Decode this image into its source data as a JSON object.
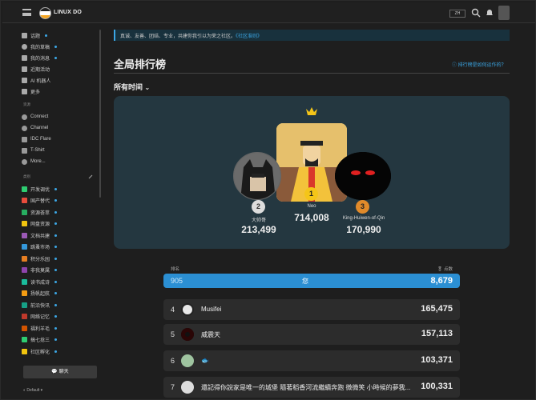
{
  "header": {
    "brand": "LINUX DO",
    "lang": "ZH"
  },
  "sidebar": {
    "top_items": [
      {
        "label": "话题",
        "dot": true
      },
      {
        "label": "我的草稿",
        "dot": true
      },
      {
        "label": "我的消息",
        "dot": true
      },
      {
        "label": "近期活动",
        "dot": false
      },
      {
        "label": "AI 机器人",
        "dot": false
      },
      {
        "label": "更多",
        "dot": false
      }
    ],
    "resources_title": "资源",
    "resources": [
      {
        "label": "Connect"
      },
      {
        "label": "Channel"
      },
      {
        "label": "IDC Flare"
      },
      {
        "label": "T-Shirt"
      },
      {
        "label": "More..."
      }
    ],
    "categories_title": "类别",
    "categories": [
      {
        "label": "开发调优",
        "color": "#2ecc71"
      },
      {
        "label": "国产替代",
        "color": "#e74c3c"
      },
      {
        "label": "资源荟萃",
        "color": "#27ae60"
      },
      {
        "label": "网盘资源",
        "color": "#f1c40f"
      },
      {
        "label": "文档共建",
        "color": "#9b59b6"
      },
      {
        "label": "跳蚤市场",
        "color": "#3498db"
      },
      {
        "label": "积分乐园",
        "color": "#e67e22"
      },
      {
        "label": "非我莫属",
        "color": "#8e44ad"
      },
      {
        "label": "读书成诗",
        "color": "#1abc9c"
      },
      {
        "label": "扬帆起航",
        "color": "#f39c12"
      },
      {
        "label": "前沿快讯",
        "color": "#16a085"
      },
      {
        "label": "网络记忆",
        "color": "#c0392b"
      },
      {
        "label": "福利羊毛",
        "color": "#d35400"
      },
      {
        "label": "搞七捻三",
        "color": "#2ecc71"
      },
      {
        "label": "社区孵化",
        "color": "#f1c40f"
      }
    ],
    "chat_label": "聊天",
    "footer_theme": "Default"
  },
  "banner": {
    "text": "真诚、友善、团结、专业，共建你我引以为荣之社区。",
    "link": "《社区准则》"
  },
  "page": {
    "title": "全局排行榜",
    "how_link": "排行榜是如何运作的？",
    "period": "所有时间"
  },
  "podium": [
    {
      "rank": "1",
      "name": "Neo",
      "score": "714,008"
    },
    {
      "rank": "2",
      "name": "大帅哥",
      "score": "213,499"
    },
    {
      "rank": "3",
      "name": "King-Huiwen-of-Qin",
      "score": "170,990"
    }
  ],
  "table": {
    "col_rank": "排名",
    "col_points": "点数",
    "me": {
      "rank": "905",
      "name": "您",
      "points": "8,679"
    },
    "rows": [
      {
        "rank": "4",
        "name": "Musifei",
        "points": "165,475"
      },
      {
        "rank": "5",
        "name": "威震天",
        "points": "157,113"
      },
      {
        "rank": "6",
        "name": "🐟",
        "points": "103,371"
      },
      {
        "rank": "7",
        "name": "還記得你說家是唯一的城堡 隨著稻香河流繼續奔跑 微微笑 小時候的夢我...",
        "points": "100,331"
      }
    ]
  }
}
